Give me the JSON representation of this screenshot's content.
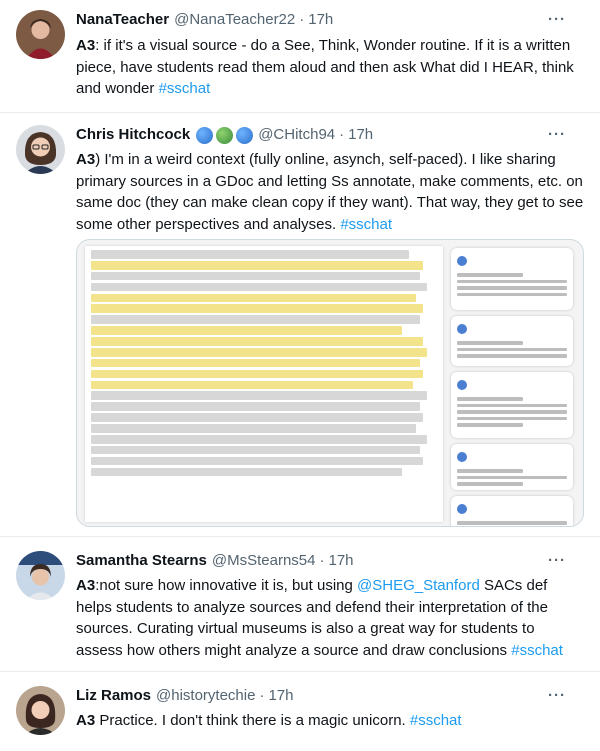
{
  "tweets": [
    {
      "name": "NanaTeacher",
      "handle": "@NanaTeacher22",
      "dot": "·",
      "time": "17h",
      "more": "···",
      "text_before": "A3",
      "text_body": ": if it's a visual source - do a See, Think, Wonder routine. If it is a written piece, have students read them aloud and then ask What did I HEAR, think and wonder ",
      "hashtag": "#sschat"
    },
    {
      "name": "Chris Hitchcock",
      "handle": "@CHitch94",
      "dot": "·",
      "time": "17h",
      "more": "···",
      "text_before": "A3",
      "text_body": ") I'm in a weird context (fully online, asynch, self-paced). I like sharing primary sources in a GDoc and letting Ss annotate, make comments, etc. on same doc (they can make clean copy if they want). That way, they get to see some other perspectives and analyses. ",
      "hashtag": "#sschat"
    },
    {
      "name": "Samantha Stearns",
      "handle": "@MsStearns54",
      "dot": "·",
      "time": "17h",
      "more": "···",
      "text_before": "A3",
      "text_body_1": ":not sure how innovative it is, but using ",
      "mention": "@SHEG_Stanford",
      "text_body_2": " SACs def helps students to analyze sources and defend their interpretation of the sources. Curating virtual museums is also a great way for students to assess how others might analyze a source and draw conclusions ",
      "hashtag": "#sschat"
    },
    {
      "name": "Liz Ramos",
      "handle": "@historytechie",
      "dot": "·",
      "time": "17h",
      "more": "···",
      "text_before": "A3",
      "text_body": " Practice. I don't think there is a magic unicorn.  ",
      "hashtag": "#sschat"
    }
  ],
  "colors": {
    "link": "#1d9bf0",
    "text": "#0f1419",
    "muted": "#536471",
    "border": "#e6ecf0",
    "highlight": "#f3e38a"
  },
  "icons": [
    "more-options-icon",
    "globe-emoji-icon",
    "avatar-photo"
  ]
}
